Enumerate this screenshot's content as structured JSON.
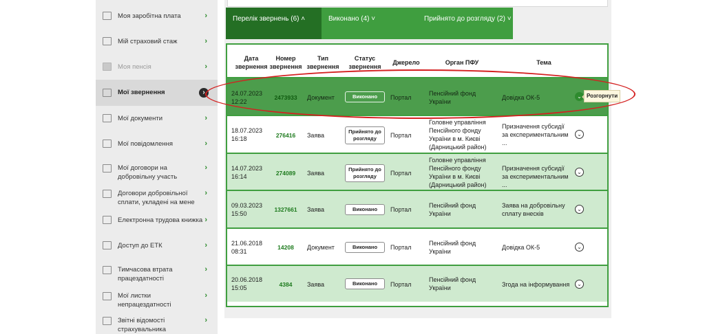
{
  "sidebar": {
    "items": [
      {
        "label": "Моя заробітна плата",
        "icon": "wallet-icon"
      },
      {
        "label": "Мій страховий стаж",
        "icon": "calendar-icon"
      },
      {
        "label": "Моя пенсія",
        "icon": "folder-icon"
      },
      {
        "label": "Мої звернення",
        "icon": "envelope-icon"
      },
      {
        "label": "Мої документи",
        "icon": "document-icon"
      },
      {
        "label": "Мої повідомлення",
        "icon": "envelope-icon"
      },
      {
        "label": "Мої договори на добровільну участь",
        "icon": "envelope-icon"
      },
      {
        "label": "Договори добровільної сплати, укладені на мене",
        "icon": "envelope-icon"
      },
      {
        "label": "Електронна трудова книжка",
        "icon": "workbook-icon"
      },
      {
        "label": "Доступ до ЕТК",
        "icon": "workbook-icon"
      },
      {
        "label": "Тимчасова втрата працездатності",
        "icon": "document-icon"
      },
      {
        "label": "Мої листки непрацездатності",
        "icon": "document-icon"
      },
      {
        "label": "Звітні відомості страхувальника",
        "icon": "document-icon"
      }
    ],
    "chevron": "›"
  },
  "tabs": [
    {
      "label": "Перелік звернень (6) ˄"
    },
    {
      "label": "Виконано (4) ˅"
    },
    {
      "label": "Прийнято до розгляду (2) ˅"
    }
  ],
  "table": {
    "headers": {
      "date": "Дата звернення",
      "number": "Номер звернення",
      "type": "Тип звернення",
      "status": "Статус звернення",
      "source": "Джерело",
      "org": "Орган ПФУ",
      "topic": "Тема"
    },
    "rows": [
      {
        "date": "24.07.2023",
        "time": "12:22",
        "number": "2473933",
        "type": "Документ",
        "status": "Виконано",
        "source": "Портал",
        "org": "Пенсійний фонд України",
        "topic": "Довідка ОК-5"
      },
      {
        "date": "18.07.2023",
        "time": "16:18",
        "number": "276416",
        "type": "Заява",
        "status": "Прийнято до розгляду",
        "source": "Портал",
        "org": "Головне управління Пенсійного фонду України в м. Києві (Дарницький район)",
        "topic": "Призначення субсидії за експериментальним ..."
      },
      {
        "date": "14.07.2023",
        "time": "16:14",
        "number": "274089",
        "type": "Заява",
        "status": "Прийнято до розгляду",
        "source": "Портал",
        "org": "Головне управління Пенсійного фонду України в м. Києві (Дарницький район)",
        "topic": "Призначення субсидії за експериментальним ..."
      },
      {
        "date": "09.03.2023",
        "time": "15:50",
        "number": "1327661",
        "type": "Заява",
        "status": "Виконано",
        "source": "Портал",
        "org": "Пенсійний фонд України",
        "topic": "Заява на добровільну сплату внесків"
      },
      {
        "date": "21.06.2018",
        "time": "08:31",
        "number": "14208",
        "type": "Документ",
        "status": "Виконано",
        "source": "Портал",
        "org": "Пенсійний фонд України",
        "topic": "Довідка ОК-5"
      },
      {
        "date": "20.06.2018",
        "time": "15:05",
        "number": "4384",
        "type": "Заява",
        "status": "Виконано",
        "source": "Портал",
        "org": "Пенсійний фонд України",
        "topic": "Згода на інформування"
      }
    ],
    "expand_symbol": "⌄"
  },
  "tooltip": {
    "label": "Розгорнути"
  },
  "colors": {
    "accent": "#3f9e3f",
    "dark_accent": "#246f24",
    "row_light": "#cfeacf",
    "row_selected": "#4c9d4c",
    "annotation": "#d42020"
  }
}
